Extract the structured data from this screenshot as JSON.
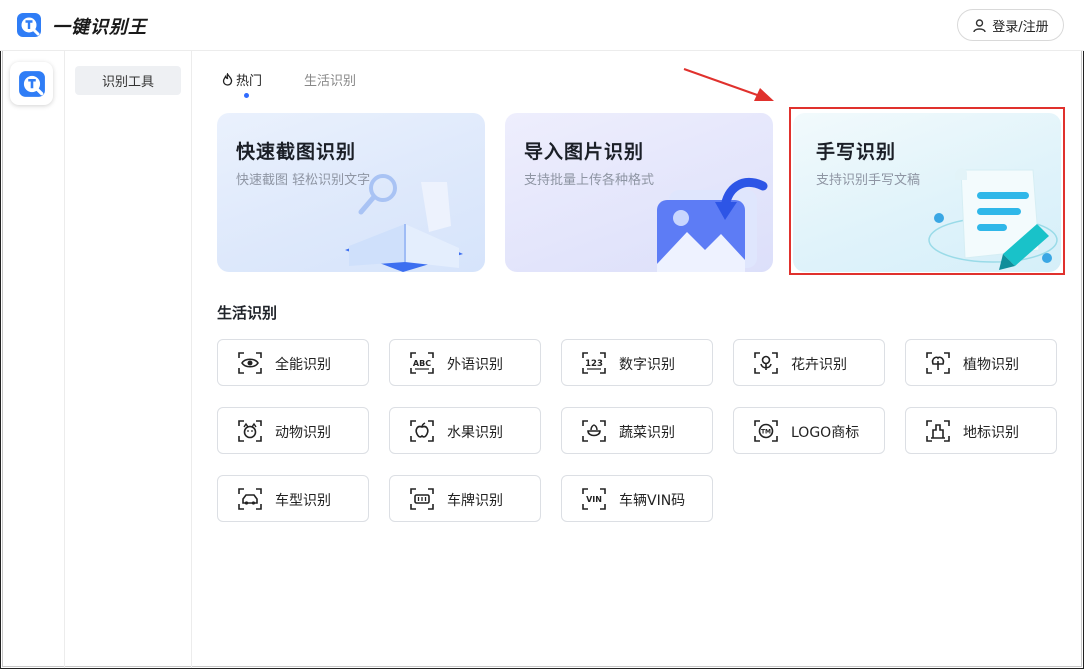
{
  "app": {
    "title": "一键识别王"
  },
  "header": {
    "login_label": "登录/注册"
  },
  "sidebar": {
    "items": [
      {
        "label": "识别工具"
      }
    ]
  },
  "tabs": [
    {
      "label": "热门",
      "active": true
    },
    {
      "label": "生活识别",
      "active": false
    }
  ],
  "featured": [
    {
      "title": "快速截图识别",
      "subtitle": "快速截图 轻松识别文字"
    },
    {
      "title": "导入图片识别",
      "subtitle": "支持批量上传各种格式"
    },
    {
      "title": "手写识别",
      "subtitle": "支持识别手写文稿"
    }
  ],
  "life_section": {
    "title": "生活识别",
    "tools": [
      {
        "label": "全能识别",
        "icon": "eye-icon"
      },
      {
        "label": "外语识别",
        "icon": "abc-icon"
      },
      {
        "label": "数字识别",
        "icon": "123-icon"
      },
      {
        "label": "花卉识别",
        "icon": "flower-icon"
      },
      {
        "label": "植物识别",
        "icon": "plant-icon"
      },
      {
        "label": "动物识别",
        "icon": "animal-icon"
      },
      {
        "label": "水果识别",
        "icon": "fruit-icon"
      },
      {
        "label": "蔬菜识别",
        "icon": "vegetable-icon"
      },
      {
        "label": "LOGO商标",
        "icon": "trademark-icon"
      },
      {
        "label": "地标识别",
        "icon": "landmark-icon"
      },
      {
        "label": "车型识别",
        "icon": "car-icon"
      },
      {
        "label": "车牌识别",
        "icon": "license-plate-icon"
      },
      {
        "label": "车辆VIN码",
        "icon": "vin-icon"
      }
    ]
  },
  "colors": {
    "accent": "#2f6bff",
    "highlight": "#e0312d"
  }
}
